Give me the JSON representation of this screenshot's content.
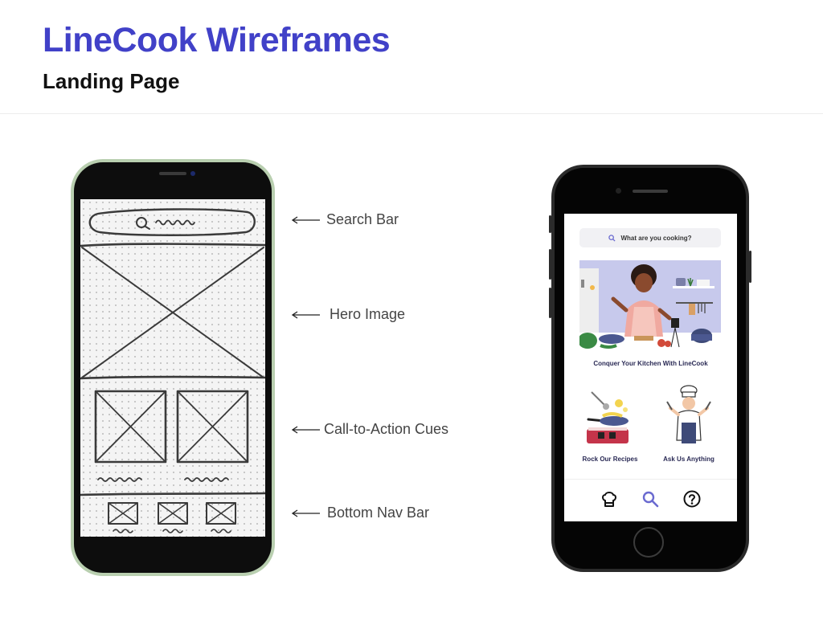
{
  "header": {
    "title": "LineCook Wireframes",
    "subtitle": "Landing Page"
  },
  "annotations": [
    {
      "label": "Search Bar"
    },
    {
      "label": "Hero Image"
    },
    {
      "label": "Call-to-Action Cues"
    },
    {
      "label": "Bottom Nav Bar"
    }
  ],
  "mockup": {
    "search_placeholder": "What are you cooking?",
    "hero_caption": "Conquer Your Kitchen With LineCook",
    "cta": [
      {
        "label": "Rock Our Recipes"
      },
      {
        "label": "Ask Us Anything"
      }
    ],
    "nav": [
      {
        "icon": "chef-hat-icon"
      },
      {
        "icon": "search-icon"
      },
      {
        "icon": "help-icon"
      }
    ]
  },
  "colors": {
    "title": "#4141c8",
    "hero_bg": "#c7c9ec",
    "accent": "#6a6ad0",
    "sketch_frame": "#b9cfb0"
  }
}
